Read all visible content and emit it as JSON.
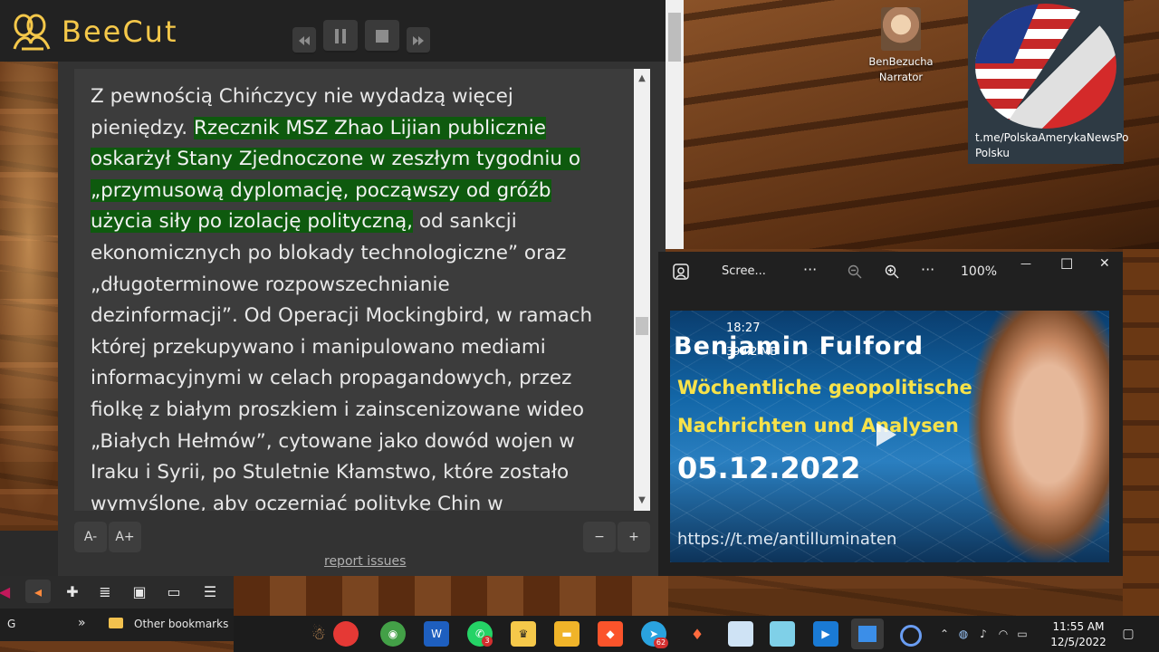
{
  "app": {
    "name": "BeeCut"
  },
  "reader": {
    "lines": [
      {
        "plain": "Z pewnością Chińczycy nie wydadzą więcej",
        "hl": "",
        "after": ""
      },
      {
        "plain": "pieniędzy. ",
        "hl": "Rzecznik MSZ Zhao Lijian publicznie",
        "after": ""
      },
      {
        "plain": "",
        "hl": "oskarżył Stany Zjednoczone w zeszłym tygodniu o",
        "after": ""
      },
      {
        "plain": "",
        "hl": "„przymusową dyplomację, począwszy od gróźb",
        "after": ""
      },
      {
        "plain": "",
        "hl": "użycia siły po izolację polityczną,",
        "after": " od sankcji"
      },
      {
        "plain": "ekonomicznych po blokady technologiczne” oraz",
        "hl": "",
        "after": ""
      },
      {
        "plain": "„długoterminowe rozpowszechnianie",
        "hl": "",
        "after": ""
      },
      {
        "plain": "dezinformacji”. Od Operacji Mockingbird, w ramach",
        "hl": "",
        "after": ""
      },
      {
        "plain": "której przekupywano i manipulowano mediami",
        "hl": "",
        "after": ""
      },
      {
        "plain": "informacyjnymi w celach propagandowych, przez",
        "hl": "",
        "after": ""
      },
      {
        "plain": "fiolkę z białym proszkiem i zainscenizowane wideo",
        "hl": "",
        "after": ""
      },
      {
        "plain": "„Białych Hełmów”, cytowane jako dowód wojen w",
        "hl": "",
        "after": ""
      },
      {
        "plain": "Iraku i Syrii, po Stuletnie Kłamstwo, które zostało",
        "hl": "",
        "after": ""
      },
      {
        "plain": "wymyślone, aby oczerniać politykę Chin w",
        "hl": "",
        "after": ""
      }
    ],
    "font_decrease": "A-",
    "font_increase": "A+",
    "zoom_minus": "−",
    "zoom_plus": "+",
    "report_link": "report issues"
  },
  "desktop": {
    "narrator_label_1": "BenBezucha",
    "narrator_label_2": "Narrator",
    "tile_line_1": "t.me/PolskaAmerykaNewsPo",
    "tile_line_2": "Polsku"
  },
  "viewer": {
    "title": "Scree...",
    "more1": "···",
    "more2": "···",
    "zoom": "100%",
    "minimize": "—",
    "maximize": "☐",
    "close": "✕",
    "video": {
      "time": "18:27",
      "size": "399.2 MB",
      "name": "Benjamin Fulford",
      "line1": "Wöchentliche geopolitische",
      "line2": "Nachrichten und Analysen",
      "date": "05.12.2022",
      "url": "https://t.me/antilluminaten"
    }
  },
  "browser": {
    "left_label": "G",
    "chevron": "»",
    "bookmarks_label": "Other bookmarks"
  },
  "taskbar": {
    "time": "11:55 AM",
    "date": "12/5/2022",
    "whatsapp_badge": "3",
    "telegram_badge": "62"
  }
}
